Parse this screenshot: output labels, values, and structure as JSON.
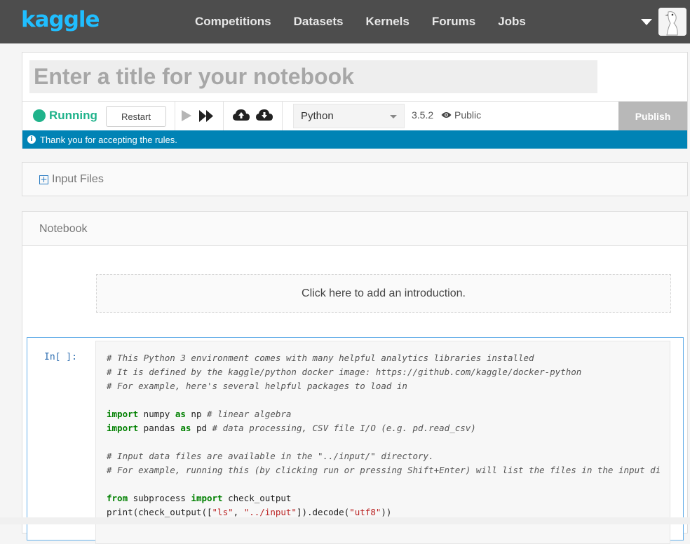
{
  "nav": {
    "logo": "kaggle",
    "links": [
      "Competitions",
      "Datasets",
      "Kernels",
      "Forums",
      "Jobs"
    ]
  },
  "editor": {
    "title_placeholder": "Enter a title for your notebook",
    "status": "Running",
    "restart_label": "Restart",
    "language": "Python",
    "version": "3.5.2",
    "visibility": "Public",
    "publish_label": "Publish",
    "notice": "Thank you for accepting the rules."
  },
  "input_files": {
    "label": "Input Files"
  },
  "notebook": {
    "label": "Notebook",
    "intro_text": "Click here to add an introduction.",
    "cell_prompt": "In[ ]:",
    "code": [
      "# This Python 3 environment comes with many helpful analytics libraries installed",
      "# It is defined by the kaggle/python docker image: https://github.com/kaggle/docker-python",
      "# For example, here's several helpful packages to load in",
      "",
      "import numpy as np # linear algebra",
      "import pandas as pd # data processing, CSV file I/O (e.g. pd.read_csv)",
      "",
      "# Input data files are available in the \"../input/\" directory.",
      "# For example, running this (by clicking run or pressing Shift+Enter) will list the files in the input di",
      "",
      "from subprocess import check_output",
      "print(check_output([\"ls\", \"../input\"]).decode(\"utf8\"))"
    ]
  },
  "colors": {
    "nav_bg": "#4d4d4d",
    "brand": "#20beff",
    "running": "#20b38b",
    "notice_bg": "#0083b5",
    "publish_bg": "#b8b8b8"
  }
}
